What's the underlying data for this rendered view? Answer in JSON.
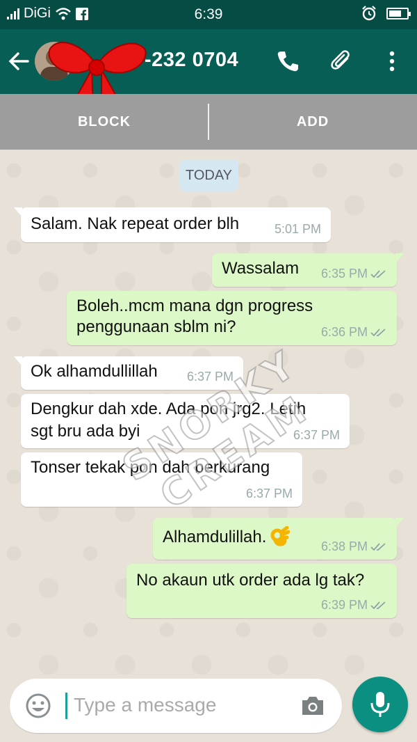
{
  "status_bar": {
    "carrier": "DiGi",
    "time": "6:39"
  },
  "header": {
    "contact_visible": "-232 0704"
  },
  "actions": {
    "block_label": "BLOCK",
    "add_label": "ADD"
  },
  "date_chip": "TODAY",
  "messages": [
    {
      "direction": "in",
      "lines": [
        "Salam. Nak repeat order blh"
      ],
      "time": "5:01 PM"
    },
    {
      "direction": "out",
      "lines": [
        "Wassalam"
      ],
      "time": "6:35 PM",
      "read": true
    },
    {
      "direction": "out",
      "lines": [
        "Boleh..mcm mana dgn progress",
        "penggunaan sblm ni?"
      ],
      "time": "6:36 PM",
      "read": true
    },
    {
      "direction": "in",
      "lines": [
        "Ok alhamdullillah"
      ],
      "time": "6:37 PM"
    },
    {
      "direction": "in",
      "lines": [
        "Dengkur dah xde. Ada pon jrg2. Letih",
        "sgt bru ada byi"
      ],
      "time": "6:37 PM"
    },
    {
      "direction": "in",
      "lines": [
        "Tonser tekak pon dah berkurang"
      ],
      "time": "6:37 PM"
    },
    {
      "direction": "out",
      "lines": [
        "Alhamdulillah."
      ],
      "emoji": "ok-hand",
      "time": "6:38 PM",
      "read": true
    },
    {
      "direction": "out",
      "lines": [
        "No akaun utk order ada lg tak?"
      ],
      "time": "6:39 PM",
      "read": true
    }
  ],
  "watermark": "SNORKY CREAM",
  "composer": {
    "placeholder": "Type a message"
  },
  "colors": {
    "header": "#075e54",
    "status_bar": "#054d44",
    "outgoing_bubble": "#dcf8c6",
    "incoming_bubble": "#ffffff",
    "fab": "#0a8f80"
  }
}
